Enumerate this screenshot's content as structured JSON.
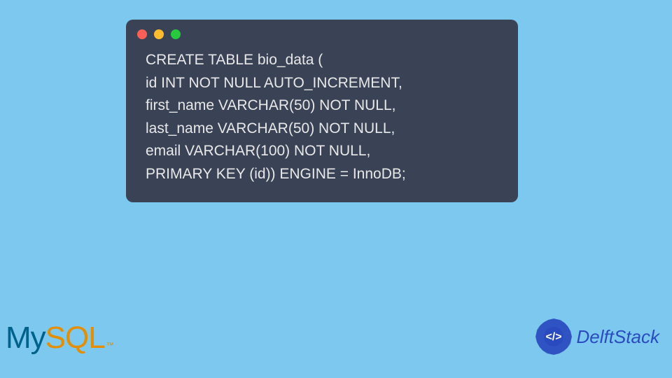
{
  "code": {
    "lines": [
      "CREATE TABLE bio_data (",
      "id INT NOT NULL AUTO_INCREMENT,",
      "first_name VARCHAR(50) NOT NULL,",
      "last_name VARCHAR(50) NOT NULL,",
      "email VARCHAR(100) NOT NULL,",
      "PRIMARY KEY (id)) ENGINE = InnoDB;"
    ]
  },
  "logos": {
    "mysql_my": "My",
    "mysql_sql": "SQL",
    "mysql_tm": "™",
    "delftstack": "DelftStack"
  }
}
